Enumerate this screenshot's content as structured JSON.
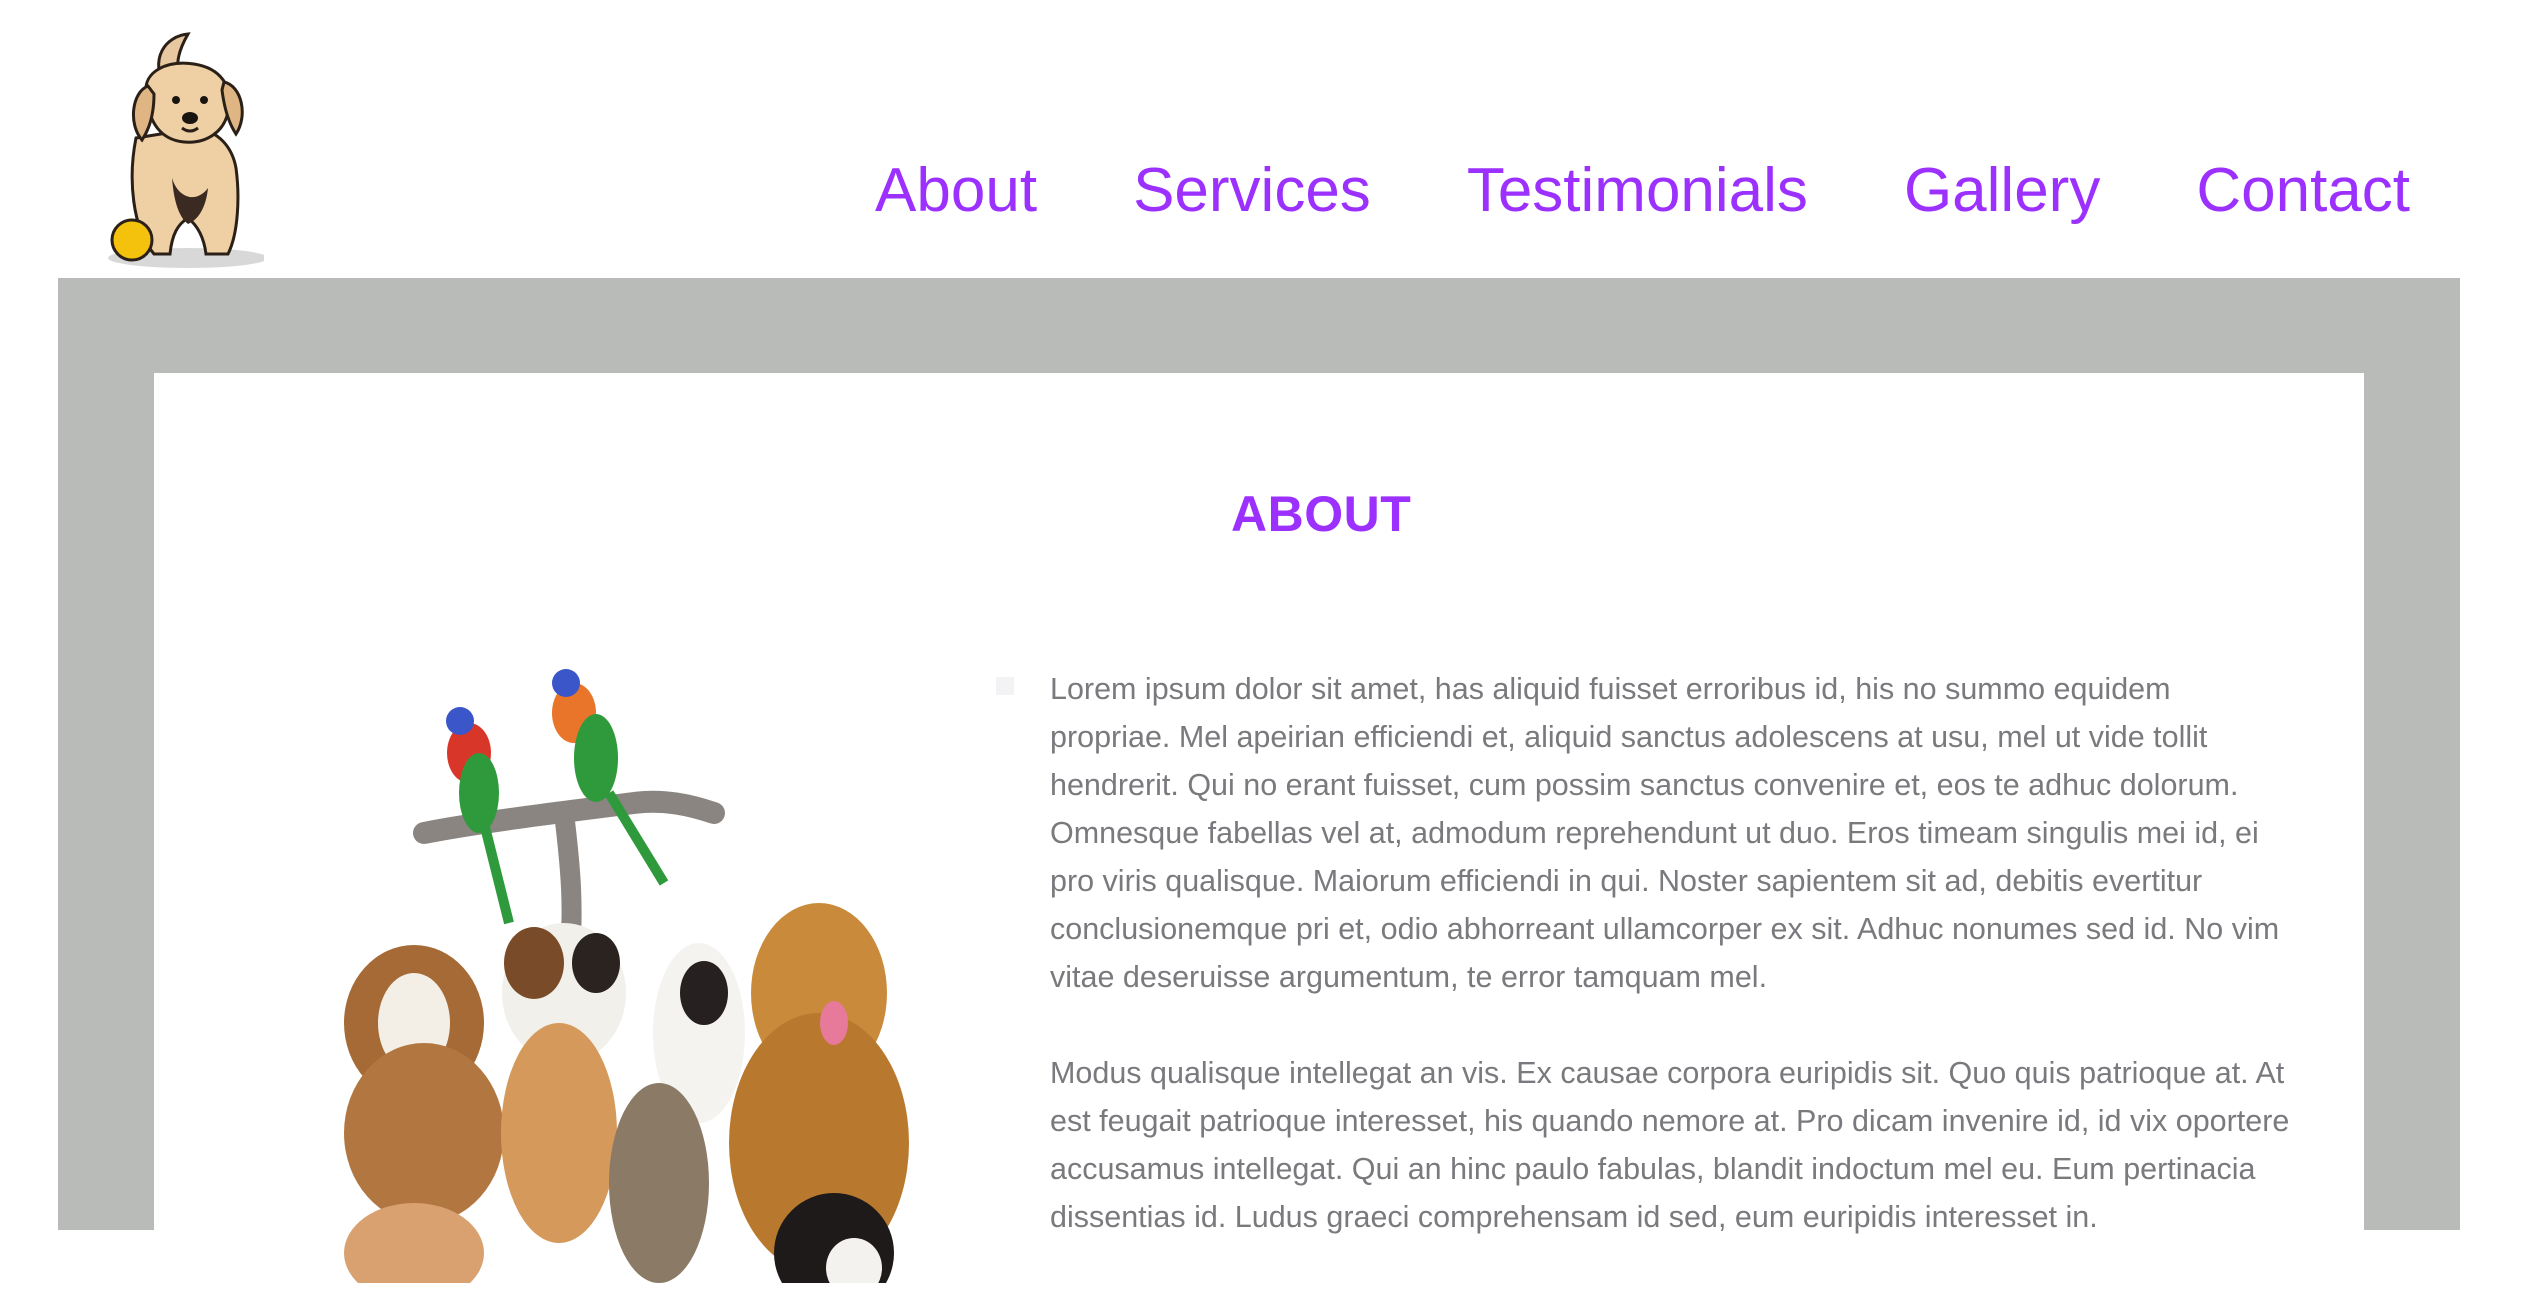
{
  "header": {
    "logo_icon": "puppy-with-ball-logo",
    "nav": [
      {
        "label": "About"
      },
      {
        "label": "Services"
      },
      {
        "label": "Testimonials"
      },
      {
        "label": "Gallery"
      },
      {
        "label": "Contact"
      }
    ]
  },
  "about": {
    "title": "ABOUT",
    "image_icon": "pets-group-image",
    "paragraphs": [
      "Lorem ipsum dolor sit amet, has aliquid fuisset erroribus id, his no summo equidem propriae. Mel apeirian efficiendi et, aliquid sanctus adolescens at usu, mel ut vide tollit hendrerit. Qui no erant fuisset, cum possim sanctus convenire et, eos te adhuc dolorum. Omnesque fabellas vel at, admodum reprehendunt ut duo. Eros timeam singulis mei id, ei pro viris qualisque. Maiorum efficiendi in qui. Noster sapientem sit ad, debitis evertitur conclusionemque pri et, odio abhorreant ullamcorper ex sit. Adhuc nonumes sed id. No vim vitae deseruisse argumentum, te error tamquam mel.",
      "Modus qualisque intellegat an vis. Ex causae corpora euripidis sit. Quo quis patrioque at. At est feugait patrioque interesset, his quando nemore at. Pro dicam invenire id, id vix oportere accusamus intellegat. Qui an hinc paulo fabulas, blandit indoctum mel eu. Eum pertinacia dissentias id. Ludus graeci comprehensam id sed, eum euripidis interesset in."
    ]
  },
  "colors": {
    "accent": "#9b30ff",
    "frame": "#b9bbb9",
    "body_text": "#7a7a7e"
  }
}
